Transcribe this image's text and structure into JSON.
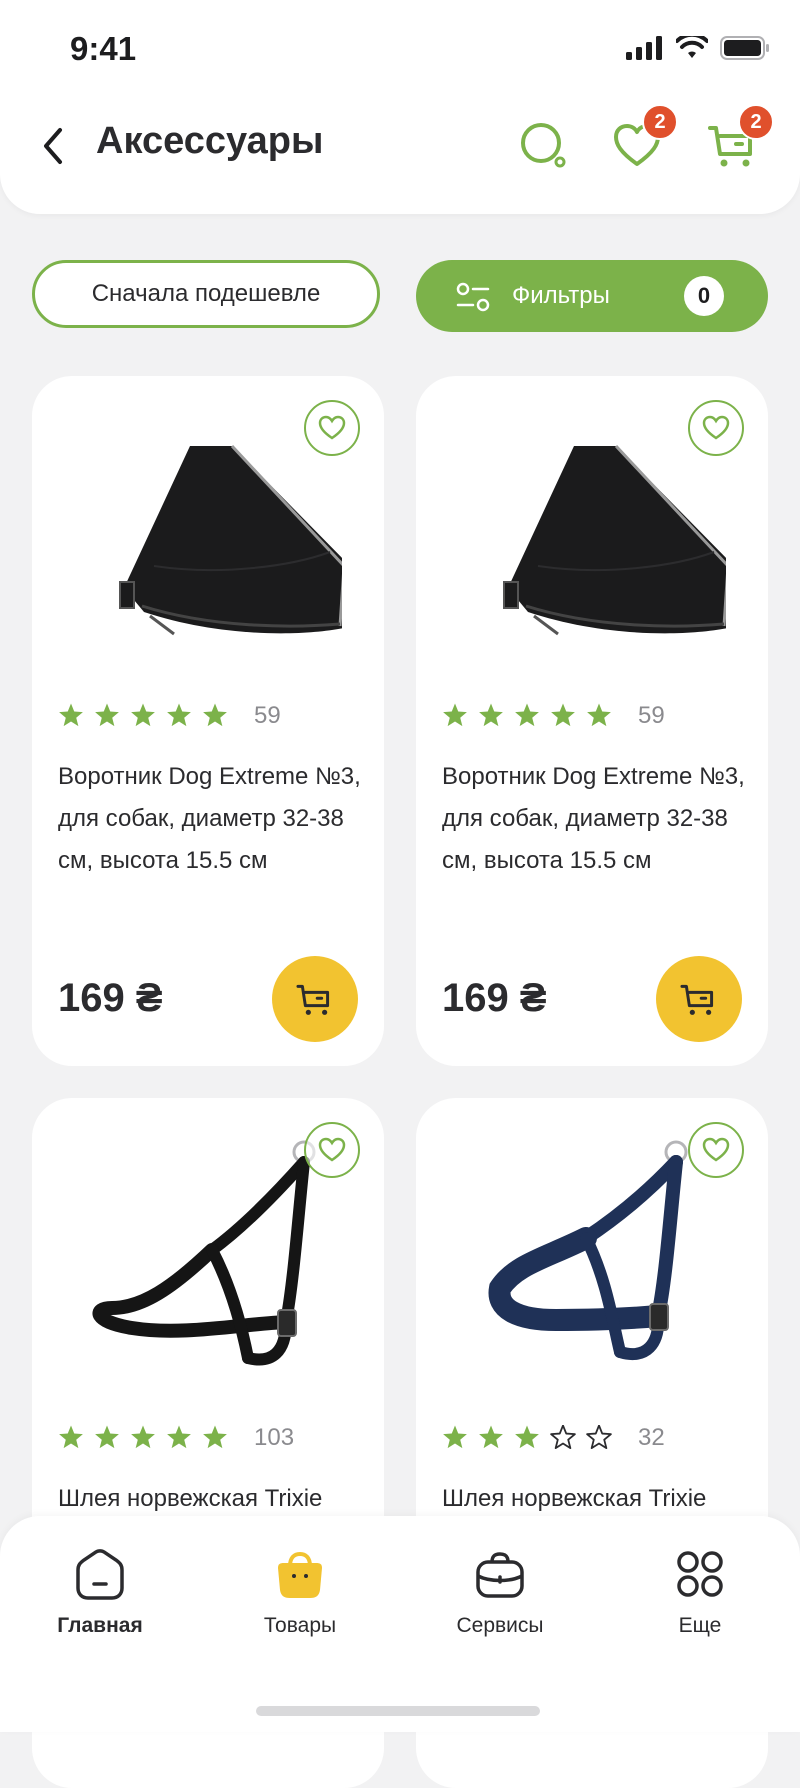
{
  "status_bar": {
    "time": "9:41"
  },
  "header": {
    "title": "Аксессуары",
    "favorites_badge": "2",
    "cart_badge": "2"
  },
  "controls": {
    "sort_label": "Сначала подешевле",
    "filter_label": "Фильтры",
    "filter_count": "0"
  },
  "products": [
    {
      "name": "Воротник Dog Extreme №3, для собак, диаметр 32-38 см, высота 15.5 см",
      "rating": 5,
      "reviews": "59",
      "price": "169 ₴",
      "image": "black-cone-collar"
    },
    {
      "name": "Воротник Dog Extreme №3, для собак, диаметр 32-38 см, высота 15.5 см",
      "rating": 5,
      "reviews": "59",
      "price": "169 ₴",
      "image": "black-cone-collar"
    },
    {
      "name": "Шлея норвежская Trixie",
      "rating": 5,
      "reviews": "103",
      "price": "",
      "image": "black-harness"
    },
    {
      "name": "Шлея норвежская Trixie",
      "rating": 3,
      "reviews": "32",
      "price": "",
      "image": "navy-harness"
    }
  ],
  "bottom_nav": [
    {
      "label": "Главная",
      "icon": "home-icon",
      "active": true
    },
    {
      "label": "Товары",
      "icon": "bag-icon",
      "active": false
    },
    {
      "label": "Сервисы",
      "icon": "briefcase-icon",
      "active": false
    },
    {
      "label": "Еще",
      "icon": "grid-icon",
      "active": false
    }
  ],
  "colors": {
    "accent": "#7cb24a",
    "cart_button": "#f2c330",
    "badge": "#e0502c",
    "background": "#f2f2f3"
  }
}
